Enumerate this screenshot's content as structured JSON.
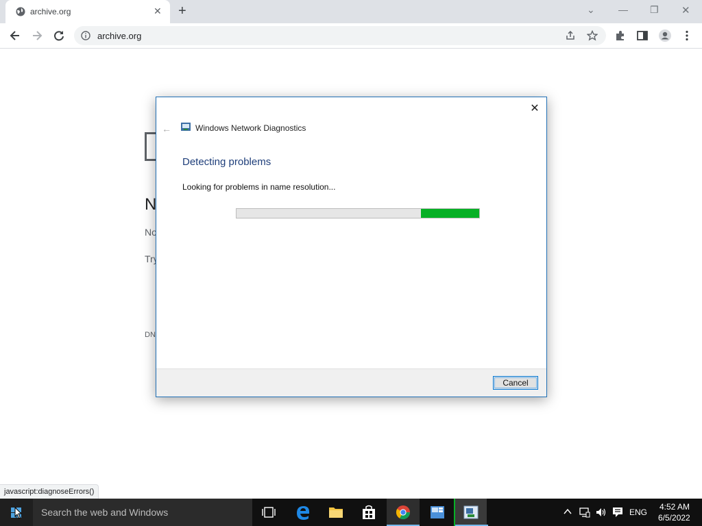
{
  "browser": {
    "tab_title": "archive.org",
    "url": "archive.org",
    "status_url": "javascript:diagnoseErrors()"
  },
  "page_fragments": {
    "heading_partial": "N",
    "line1_partial": "No",
    "line2_partial": "Try",
    "code_partial": "DN"
  },
  "dialog": {
    "app_title": "Windows Network Diagnostics",
    "heading": "Detecting problems",
    "status": "Looking for problems in name resolution...",
    "progress_fraction": 0.24,
    "cancel_label": "Cancel"
  },
  "taskbar": {
    "search_placeholder": "Search the web and Windows",
    "language": "ENG",
    "time": "4:52 AM",
    "date": "6/5/2022"
  },
  "colors": {
    "progress_green": "#06b025",
    "dialog_heading": "#1e3e7a",
    "dialog_border": "#1f6fb5"
  }
}
